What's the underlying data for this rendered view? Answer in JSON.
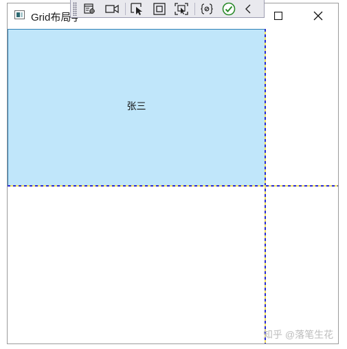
{
  "window": {
    "title": "Grid布局学",
    "controls": {
      "maximize": "maximize-icon",
      "close": "close-icon"
    }
  },
  "debug_toolbar": {
    "icons": [
      "visual-tree-icon",
      "video-camera-icon",
      "select-element-icon",
      "display-layout-adorner-icon",
      "track-focus-icon",
      "binding-failures-icon",
      "checkmark-circle-icon",
      "collapse-chevron-icon"
    ],
    "accent": "#2a8a2a"
  },
  "grid": {
    "cell_text": "张三",
    "cell_color": "#c0e6fa",
    "gridline_colors": [
      "#2a2ad0",
      "#f0e060"
    ]
  },
  "watermark": "知乎 @落笔生花"
}
